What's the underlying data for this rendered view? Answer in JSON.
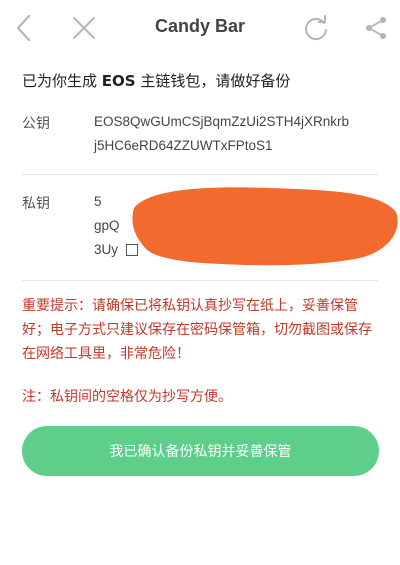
{
  "nav": {
    "title": "Candy Bar",
    "back_icon": "chevron-left-icon",
    "close_icon": "close-icon",
    "refresh_icon": "refresh-icon",
    "share_icon": "share-icon"
  },
  "headline": {
    "prefix": "已为你生成 ",
    "eos": "EOS",
    "suffix": " 主链钱包，请做好备份"
  },
  "public_key": {
    "label": "公钥",
    "line1": "EOS8QwGUmCSjBqmZzUi2STH4jXRnkrb",
    "line2": "j5HC6eRD64ZZUWTxFPtoS1"
  },
  "private_key": {
    "label": "私钥",
    "line1": "5",
    "line2": "gpQ",
    "line3": "3Uy",
    "redaction_color": "#f26a2e"
  },
  "warning": "重要提示：请确保已将私钥认真抄写在纸上，妥善保管好；电子方式只建议保存在密码保管箱，切勿截图或保存在网络工具里，非常危险！",
  "note": "注：私钥间的空格仅为抄写方便。",
  "confirm_button": "我已确认备份私钥并妥善保管",
  "colors": {
    "accent": "#5ecf8b",
    "warning": "#c0392b"
  }
}
